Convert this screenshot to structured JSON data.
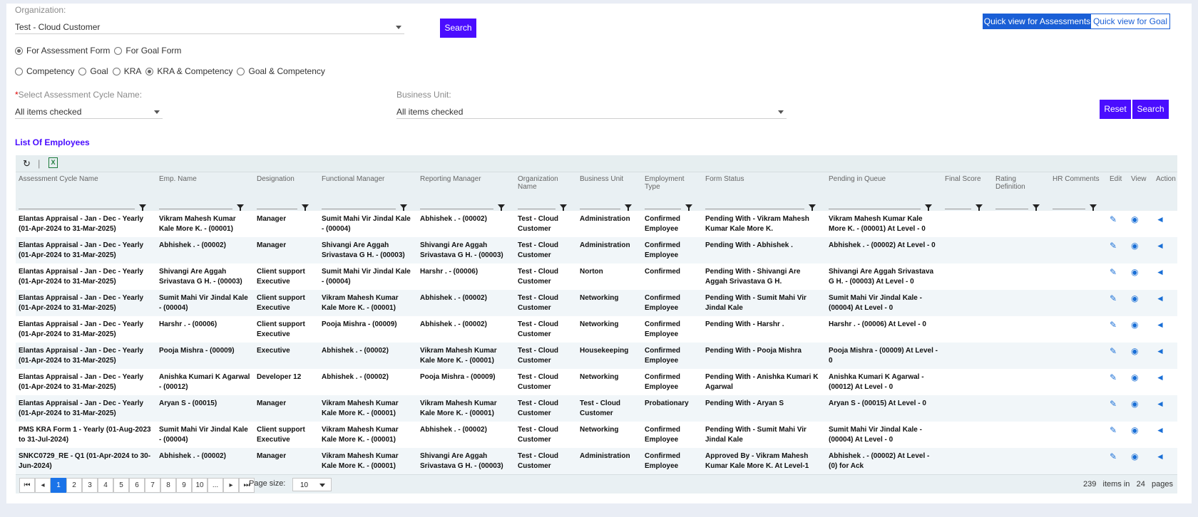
{
  "filters": {
    "org_label": "Organization:",
    "org_value": "Test - Cloud Customer",
    "search_label": "Search",
    "quick_assess": "Quick view for Assessments",
    "quick_goal": "Quick view for Goal",
    "form_options": [
      "For Assessment Form",
      "For Goal Form"
    ],
    "type_options": [
      "Competency",
      "Goal",
      "KRA",
      "KRA & Competency",
      "Goal & Competency"
    ],
    "cycle_required": "*",
    "cycle_label": "Select Assessment Cycle Name:",
    "cycle_value": "All items checked",
    "bu_label": "Business Unit:",
    "bu_value": "All items checked",
    "reset_label": "Reset",
    "search2_label": "Search"
  },
  "list_title": "List Of Employees",
  "columns": [
    "Assessment Cycle Name",
    "Emp. Name",
    "Designation",
    "Functional Manager",
    "Reporting Manager",
    "Organization Name",
    "Business Unit",
    "Employment Type",
    "Form Status",
    "Pending in Queue",
    "Final Score",
    "Rating Definition",
    "HR Comments",
    "Edit",
    "View",
    "Action"
  ],
  "rows": [
    [
      "Elantas Appraisal - Jan - Dec - Yearly (01-Apr-2024 to 31-Mar-2025)",
      "Vikram Mahesh Kumar Kale More K. - (00001)",
      "Manager",
      "Sumit Mahi Vir Jindal Kale - (00004)",
      "Abhishek . - (00002)",
      "Test - Cloud Customer",
      "Administration",
      "Confirmed Employee",
      "Pending With - Vikram Mahesh Kumar Kale More K.",
      "Vikram Mahesh Kumar Kale More K. - (00001) At Level - 0"
    ],
    [
      "Elantas Appraisal - Jan - Dec - Yearly (01-Apr-2024 to 31-Mar-2025)",
      "Abhishek . - (00002)",
      "Manager",
      "Shivangi Are Aggah Srivastava G H. - (00003)",
      "Shivangi Are Aggah Srivastava G H. - (00003)",
      "Test - Cloud Customer",
      "Administration",
      "Confirmed Employee",
      "Pending With - Abhishek .",
      "Abhishek . - (00002) At Level - 0"
    ],
    [
      "Elantas Appraisal - Jan - Dec - Yearly (01-Apr-2024 to 31-Mar-2025)",
      "Shivangi Are Aggah Srivastava G H. - (00003)",
      "Client support Executive",
      "Sumit Mahi Vir Jindal Kale - (00004)",
      "Harshr . - (00006)",
      "Test - Cloud Customer",
      "Norton",
      "Confirmed",
      "Pending With - Shivangi Are Aggah Srivastava G H.",
      "Shivangi Are Aggah Srivastava G H. - (00003) At Level - 0"
    ],
    [
      "Elantas Appraisal - Jan - Dec - Yearly (01-Apr-2024 to 31-Mar-2025)",
      "Sumit Mahi Vir Jindal Kale - (00004)",
      "Client support Executive",
      "Vikram Mahesh Kumar Kale More K. - (00001)",
      "Abhishek . - (00002)",
      "Test - Cloud Customer",
      "Networking",
      "Confirmed Employee",
      "Pending With - Sumit Mahi Vir Jindal Kale",
      "Sumit Mahi Vir Jindal Kale - (00004) At Level - 0"
    ],
    [
      "Elantas Appraisal - Jan - Dec - Yearly (01-Apr-2024 to 31-Mar-2025)",
      "Harshr . - (00006)",
      "Client support Executive",
      "Pooja Mishra - (00009)",
      "Abhishek . - (00002)",
      "Test - Cloud Customer",
      "Networking",
      "Confirmed Employee",
      "Pending With - Harshr .",
      "Harshr . - (00006) At Level - 0"
    ],
    [
      "Elantas Appraisal - Jan - Dec - Yearly (01-Apr-2024 to 31-Mar-2025)",
      "Pooja Mishra - (00009)",
      "Executive",
      "Abhishek . - (00002)",
      "Vikram Mahesh Kumar Kale More K. - (00001)",
      "Test - Cloud Customer",
      "Housekeeping",
      "Confirmed Employee",
      "Pending With - Pooja Mishra",
      "Pooja Mishra - (00009) At Level - 0"
    ],
    [
      "Elantas Appraisal - Jan - Dec - Yearly (01-Apr-2024 to 31-Mar-2025)",
      "Anishka Kumari K Agarwal - (00012)",
      "Developer 12",
      "Abhishek . - (00002)",
      "Pooja Mishra - (00009)",
      "Test - Cloud Customer",
      "Networking",
      "Confirmed Employee",
      "Pending With - Anishka Kumari K Agarwal",
      "Anishka Kumari K Agarwal - (00012) At Level - 0"
    ],
    [
      "Elantas Appraisal - Jan - Dec - Yearly (01-Apr-2024 to 31-Mar-2025)",
      "Aryan S - (00015)",
      "Manager",
      "Vikram Mahesh Kumar Kale More K. - (00001)",
      "Vikram Mahesh Kumar Kale More K. - (00001)",
      "Test - Cloud Customer",
      "Test - Cloud Customer",
      "Probationary",
      "Pending With - Aryan S",
      "Aryan S - (00015) At Level - 0"
    ],
    [
      "PMS KRA Form 1 - Yearly (01-Aug-2023 to 31-Jul-2024)",
      "Sumit Mahi Vir Jindal Kale - (00004)",
      "Client support Executive",
      "Vikram Mahesh Kumar Kale More K. - (00001)",
      "Abhishek . - (00002)",
      "Test - Cloud Customer",
      "Networking",
      "Confirmed Employee",
      "Pending With - Sumit Mahi Vir Jindal Kale",
      "Sumit Mahi Vir Jindal Kale - (00004) At Level - 0"
    ],
    [
      "SNKC0729_RE - Q1 (01-Apr-2024 to 30-Jun-2024)",
      "Abhishek . - (00002)",
      "Manager",
      "Vikram Mahesh Kumar Kale More K. - (00001)",
      "Shivangi Are Aggah Srivastava G H. - (00003)",
      "Test - Cloud Customer",
      "Administration",
      "Confirmed Employee",
      "Approved By - Vikram Mahesh Kumar Kale More K. At Level-1",
      "Abhishek . - (00002) At Level - (0) for Ack"
    ]
  ],
  "pager": {
    "pages": [
      "1",
      "2",
      "3",
      "4",
      "5",
      "6",
      "7",
      "8",
      "9",
      "10",
      "..."
    ],
    "page_size_label": "Page size:",
    "page_size": "10",
    "total_items": "239",
    "items_in": "items in",
    "total_pages": "24",
    "pages_label": "pages"
  },
  "icons": {
    "refresh": "refresh-icon",
    "excel": "excel-icon",
    "edit": "edit-icon",
    "view": "eye-icon",
    "action": "megaphone-icon"
  },
  "colors": {
    "primary": "#4a0dff",
    "link": "#1a73e8"
  }
}
